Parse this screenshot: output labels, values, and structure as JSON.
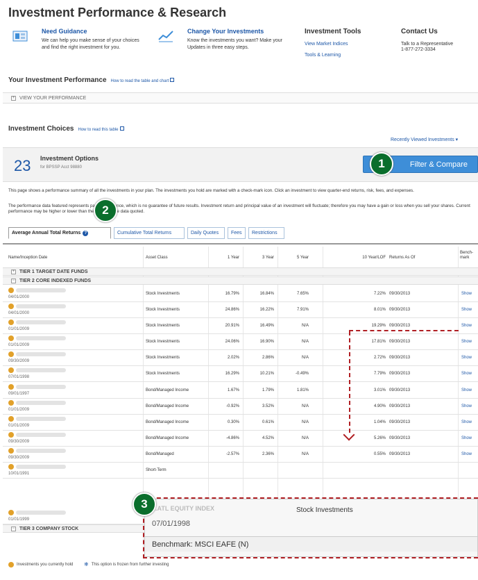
{
  "page_title": "Investment Performance & Research",
  "promos": [
    {
      "icon": "guidance-icon",
      "title": "Need Guidance",
      "desc": "We can help you make sense of your choices and find the right investment for you."
    },
    {
      "icon": "chart-icon",
      "title": "Change Your Investments",
      "desc": "Know the investments you want? Make your Updates in three easy steps."
    }
  ],
  "tools": {
    "title": "Investment Tools",
    "link1": "View Market Indices",
    "link2": "Tools & Learning"
  },
  "contact": {
    "title": "Contact Us",
    "line1": "Talk to a Representative",
    "line2": "1-877-272-3334"
  },
  "performance": {
    "title": "Your Investment Performance",
    "help_link": "How to read the table and chart",
    "expander": "VIEW YOUR PERFORMANCE"
  },
  "choices": {
    "title": "Investment Choices",
    "help_link": "How to read this table",
    "recent": "Recently Viewed Investments"
  },
  "options": {
    "count": "23",
    "title": "Investment Options",
    "subtitle": "for BPSSP Acct 98880",
    "filter_button": "Filter & Compare"
  },
  "paragraphs": {
    "p1": "This page shows a performance summary of all the investments in your plan. The investments you hold are marked with a check-mark icon. Click an investment to view quarter-end returns, risk, fees, and expenses.",
    "p2": "The performance data featured represents past performance, which is no guarantee of future results. Investment return and principal value of an investment will fluctuate; therefore you may have a gain or loss when you sell your shares. Current performance may be higher or lower than the performance data quoted."
  },
  "tabs": [
    "Average Annual Total Returns",
    "Cumulative Total Returns",
    "Daily Quotes",
    "Fees",
    "Restrictions"
  ],
  "headers": {
    "name": "Name/Inception Date",
    "asset": "Asset Class",
    "y1": "1 Year",
    "y3": "3 Year",
    "y5": "5 Year",
    "y10": "10 Year/LOF",
    "asof": "Returns As Of",
    "bench1": "Bench-",
    "bench2": "mark"
  },
  "groups": {
    "g1": "TIER 1 TARGET DATE FUNDS",
    "g2": "TIER 2 CORE INDEXED FUNDS",
    "g3": "TIER 3 COMPANY STOCK"
  },
  "rows": [
    {
      "date": "04/01/2000",
      "asset": "Stock Investments",
      "y1": "16.79%",
      "y3": "16.84%",
      "y5": "7.65%",
      "y10": "7.22%",
      "asof": "09/30/2013",
      "show": "Show"
    },
    {
      "date": "04/01/2000",
      "asset": "Stock Investments",
      "y1": "24.86%",
      "y3": "16.22%",
      "y5": "7.91%",
      "y10": "8.01%",
      "asof": "09/30/2013",
      "show": "Show"
    },
    {
      "date": "01/01/2009",
      "asset": "Stock Investments",
      "y1": "20.91%",
      "y3": "16.49%",
      "y5": "N/A",
      "y10": "19.29%",
      "asof": "09/30/2013",
      "show": "Show"
    },
    {
      "date": "01/01/2009",
      "asset": "Stock Investments",
      "y1": "24.06%",
      "y3": "16.90%",
      "y5": "N/A",
      "y10": "17.81%",
      "asof": "09/30/2013",
      "show": "Show"
    },
    {
      "date": "09/30/2009",
      "asset": "Stock Investments",
      "y1": "2.02%",
      "y3": "2.86%",
      "y5": "N/A",
      "y10": "2.72%",
      "asof": "09/30/2013",
      "show": "Show"
    },
    {
      "date": "07/01/1998",
      "asset": "Stock Investments",
      "y1": "16.29%",
      "y3": "10.21%",
      "y5": "-0.49%",
      "y10": "7.79%",
      "asof": "09/30/2013",
      "show": "Show"
    },
    {
      "date": "09/01/1997",
      "asset": "Bond/Managed Income",
      "y1": "1.67%",
      "y3": "1.79%",
      "y5": "1.81%",
      "y10": "3.01%",
      "asof": "09/30/2013",
      "show": "Show"
    },
    {
      "date": "01/01/2009",
      "asset": "Bond/Managed Income",
      "y1": "-0.92%",
      "y3": "3.52%",
      "y5": "N/A",
      "y10": "4.90%",
      "asof": "09/30/2013",
      "show": "Show"
    },
    {
      "date": "01/01/2009",
      "asset": "Bond/Managed Income",
      "y1": "0.30%",
      "y3": "0.61%",
      "y5": "N/A",
      "y10": "1.04%",
      "asof": "09/30/2013",
      "show": "Show"
    },
    {
      "date": "09/30/2009",
      "asset": "Bond/Managed Income",
      "y1": "-4.86%",
      "y3": "4.52%",
      "y5": "N/A",
      "y10": "5.26%",
      "asof": "09/30/2013",
      "show": "Show"
    },
    {
      "date": "09/30/2009",
      "asset": "Bond/Managed",
      "y1": "-2.57%",
      "y3": "2.36%",
      "y5": "N/A",
      "y10": "0.55%",
      "asof": "09/30/2013",
      "show": "Show"
    },
    {
      "date": "10/01/1991",
      "asset": "Short-Term",
      "y1": "",
      "y3": "",
      "y5": "",
      "y10": "",
      "asof": "",
      "show": ""
    },
    {
      "date": "01/01/1999",
      "asset": "Stock Investments",
      "y1": "",
      "y3": "",
      "y5": "",
      "y10": "",
      "asof": "",
      "show": ""
    }
  ],
  "popup": {
    "title": "...ATL EQUITY INDEX",
    "asset_class": "Stock Investments",
    "date": "07/01/1998",
    "benchmark": "Benchmark: MSCI EAFE (N)"
  },
  "badges": [
    "1",
    "2",
    "3"
  ],
  "legend": {
    "held": "Investments you currently hold",
    "frozen": "This option is frozen from further investing"
  },
  "colors": {
    "link": "#1d57a7",
    "filter_button": "#3e8ed8",
    "badge": "#0a6e2c",
    "annotation": "#b01e23",
    "held_marker": "#e2a12a"
  }
}
